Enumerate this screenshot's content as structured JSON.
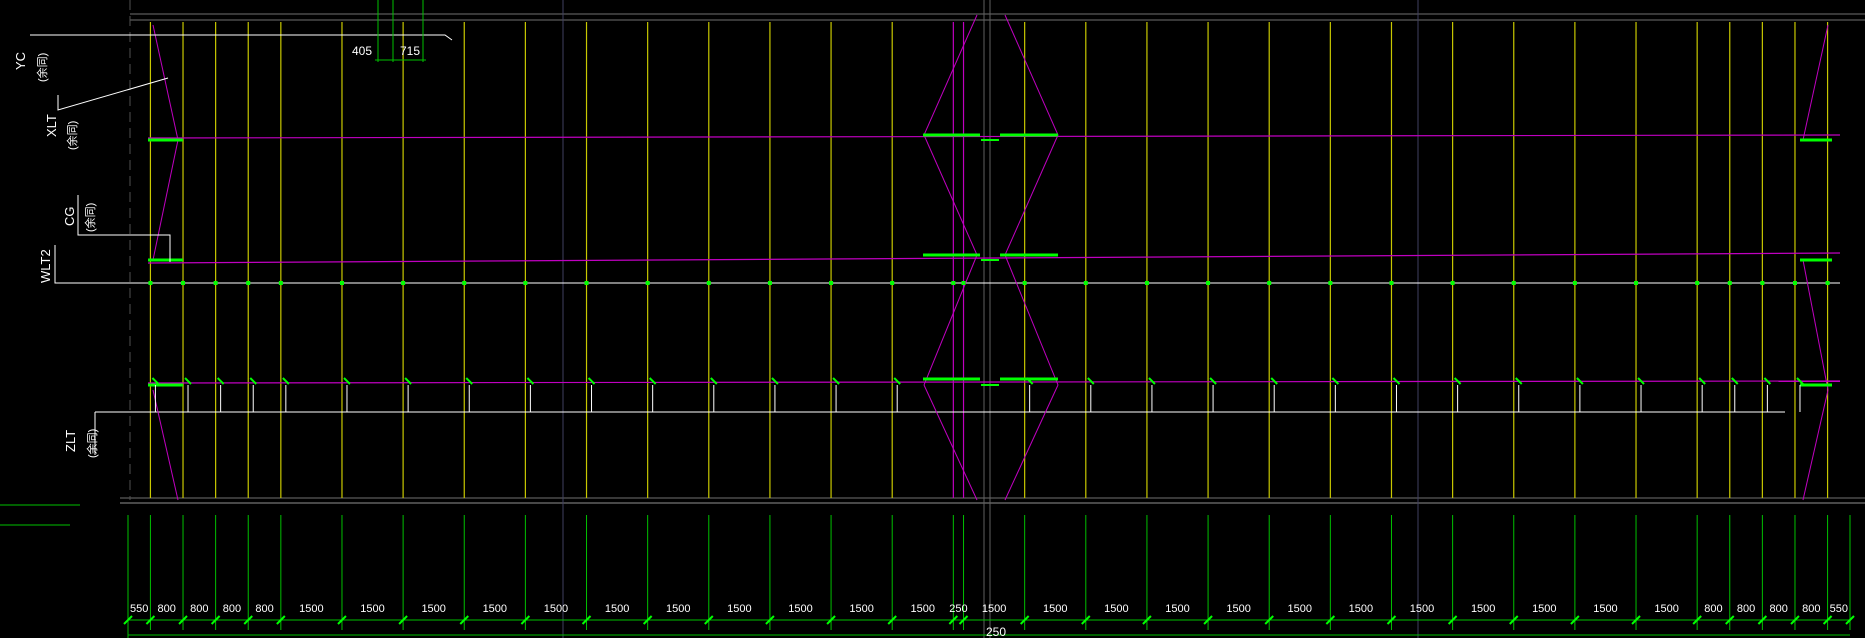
{
  "tags": {
    "yc": "YC",
    "xlt": "XLT",
    "cg": "CG",
    "wlt2": "WLT2",
    "zlt": "ZLT",
    "note": "(余同)"
  },
  "top_dims": [
    "405",
    "715"
  ],
  "bottom_dims": [
    "550",
    "800",
    "800",
    "800",
    "800",
    "1500",
    "1500",
    "1500",
    "1500",
    "1500",
    "1500",
    "1500",
    "1500",
    "1500",
    "1500",
    "1500",
    "250",
    "1500",
    "1500",
    "1500",
    "1500",
    "1500",
    "1500",
    "1500",
    "1500",
    "1500",
    "1500",
    "1500",
    "1500",
    "800",
    "800",
    "800",
    "800",
    "550"
  ],
  "bottom_total_label": "250",
  "colors": {
    "background": "#000000",
    "column": "#c8c800",
    "beam": "#c000c0",
    "bracket": "#00ff00",
    "tie": "#ffffff",
    "dimension": "#00c000",
    "guide": "#606060"
  }
}
